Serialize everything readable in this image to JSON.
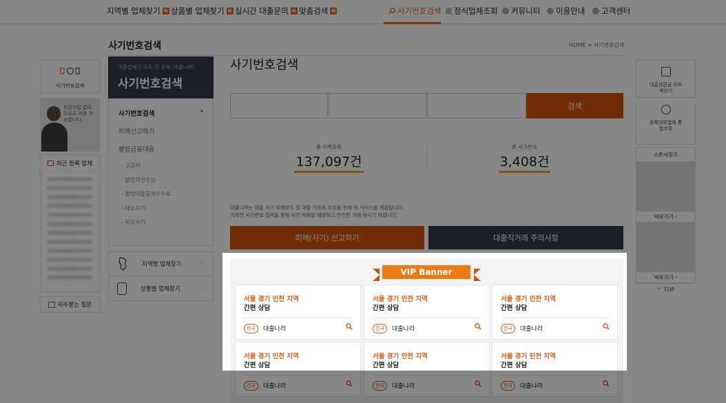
{
  "topnav": {
    "items": [
      {
        "label": "지역별 업체찾기",
        "new": "N"
      },
      {
        "label": "상품별 업체찾기",
        "new": "N"
      },
      {
        "label": "실시간 대출문의",
        "new": "N"
      },
      {
        "label": "맞춤검색",
        "new": "N"
      },
      {
        "label": "사기번호검색"
      },
      {
        "label": "정식업체조회"
      },
      {
        "label": "커뮤니티"
      },
      {
        "label": "이용안내"
      },
      {
        "label": "고객센터"
      }
    ]
  },
  "page": {
    "title": "사기번호검색",
    "breadcrumb": "HOME > 사기번호검색"
  },
  "left_quick": {
    "search_label": "사기번호검색",
    "promo": "회원가입 없이 무료로 이용 가능합니다.",
    "recent_header": "최근 등록 업체",
    "faq": "자주묻는 질문"
  },
  "sidemenu": {
    "hero_small": "대출업체가 모두 한 곳에, 대출나라!",
    "hero_title": "사기번호검색",
    "items": [
      "사기번호검색",
      "피해신고하기",
      "불법금융대응"
    ],
    "subs": [
      "고금리",
      "불법채권추심",
      "불법대출중개수수료",
      "대포사기",
      "피싱사기"
    ],
    "links": [
      "지역별 업체찾기",
      "상품별 업체찾기"
    ]
  },
  "main": {
    "title": "사기번호검색",
    "search_button": "검색",
    "stats": [
      {
        "label": "총 이력조회",
        "value": "137,097건"
      },
      {
        "label": "총 사기번호",
        "value": "3,408건"
      }
    ],
    "notice": [
      "대출나라는 대출 사기 피해방지 및 대출 이용자 보호를 위해 위 서비스를 제공합니다.",
      "거래전 사기번호 검색을 통해 사기 피해를 예방하고 안전한 거래 하시기 바랍니다."
    ],
    "report_button": "피해(사기) 신고하기",
    "caution_button": "대출직거래 주의사항"
  },
  "vip": {
    "banner": "VIP Banner",
    "cards": [
      {
        "region": "서울 경기 인천 지역",
        "product": "간편 상담",
        "tag": "전국",
        "company": "대출나라"
      },
      {
        "region": "서울 경기 인천 지역",
        "product": "간편 상담",
        "tag": "전국",
        "company": "대출나라"
      },
      {
        "region": "서울 경기 인천 지역",
        "product": "간편 상담",
        "tag": "전국",
        "company": "대출나라"
      },
      {
        "region": "서울 경기 인천 지역",
        "product": "간편 상담",
        "tag": "전국",
        "company": "대출나라"
      },
      {
        "region": "서울 경기 인천 지역",
        "product": "간편 상담",
        "tag": "전국",
        "company": "대출나라"
      },
      {
        "region": "서울 경기 인천 지역",
        "product": "간편 상담",
        "tag": "전국",
        "company": "대출나라"
      }
    ]
  },
  "right_quick": {
    "calc": "대출상환금 이자계산기",
    "registry": "등록대부업체 통합조회",
    "sponsor_header": "스폰서링크",
    "goto": "바로가기",
    "top": "TOP"
  },
  "colors": {
    "accent": "#d3520e",
    "dark": "#333d48",
    "vip": "#ee7a14"
  }
}
